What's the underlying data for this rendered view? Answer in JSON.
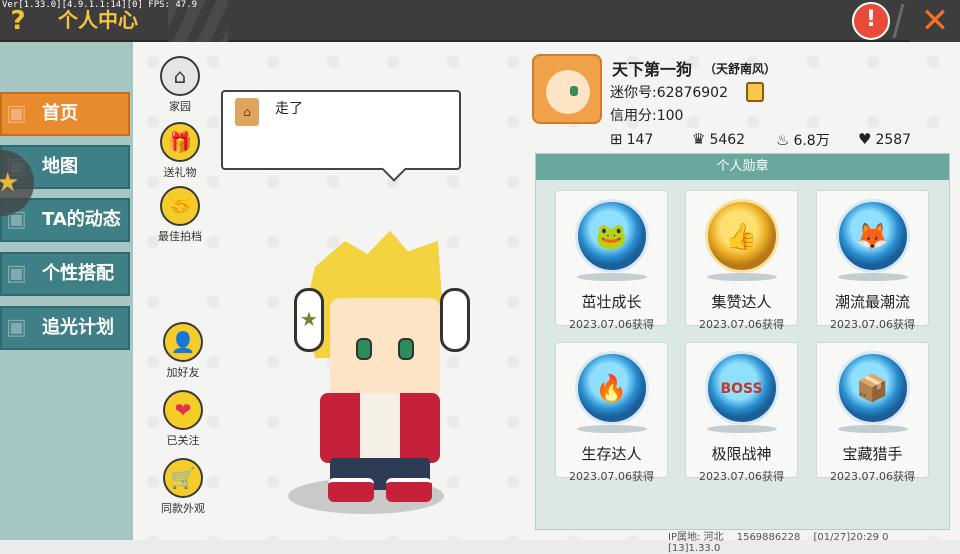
{
  "debug": "Ver[1.33.0][4.9.1.1:14][0] FPS: 47.9",
  "header": {
    "title": "个人中心",
    "help_icon": "question-icon",
    "warn_icon": "warning-icon",
    "close_icon": "close-icon"
  },
  "nav": [
    {
      "label": "首页",
      "active": true
    },
    {
      "label": "地图",
      "active": false
    },
    {
      "label": "TA的动态",
      "active": false
    },
    {
      "label": "个性搭配",
      "active": false
    },
    {
      "label": "追光计划",
      "active": false
    }
  ],
  "actions_top": [
    {
      "label": "家园"
    },
    {
      "label": "送礼物"
    },
    {
      "label": "最佳拍档"
    }
  ],
  "actions_bottom": [
    {
      "label": "加好友"
    },
    {
      "label": "已关注"
    },
    {
      "label": "同款外观"
    }
  ],
  "speech": {
    "text": "走了"
  },
  "profile": {
    "name": "天下第一狗",
    "subname": "（天舒南风）",
    "id": "迷你号:62876902",
    "credit": "信用分:100",
    "stats": [
      {
        "icon": "plus-square-icon",
        "value": "147"
      },
      {
        "icon": "trophy-icon",
        "value": "5462"
      },
      {
        "icon": "flame-icon",
        "value": "6.8万"
      },
      {
        "icon": "heart-icon",
        "value": "2587"
      }
    ]
  },
  "medals": {
    "title": "个人勋章",
    "items": [
      {
        "name": "茁壮成长",
        "date": "2023.07.06获得",
        "style": "blue"
      },
      {
        "name": "集赞达人",
        "date": "2023.07.06获得",
        "style": "gold"
      },
      {
        "name": "潮流最潮流",
        "date": "2023.07.06获得",
        "style": "blue"
      },
      {
        "name": "生存达人",
        "date": "2023.07.06获得",
        "style": "blue"
      },
      {
        "name": "极限战神",
        "date": "2023.07.06获得",
        "style": "blue"
      },
      {
        "name": "宝藏猎手",
        "date": "2023.07.06获得",
        "style": "blue"
      }
    ]
  },
  "footer": {
    "ip": "IP属地: 河北",
    "uid": "1569886228",
    "time": "[01/27]20:29 0",
    "ver": "[13]1.33.0"
  }
}
